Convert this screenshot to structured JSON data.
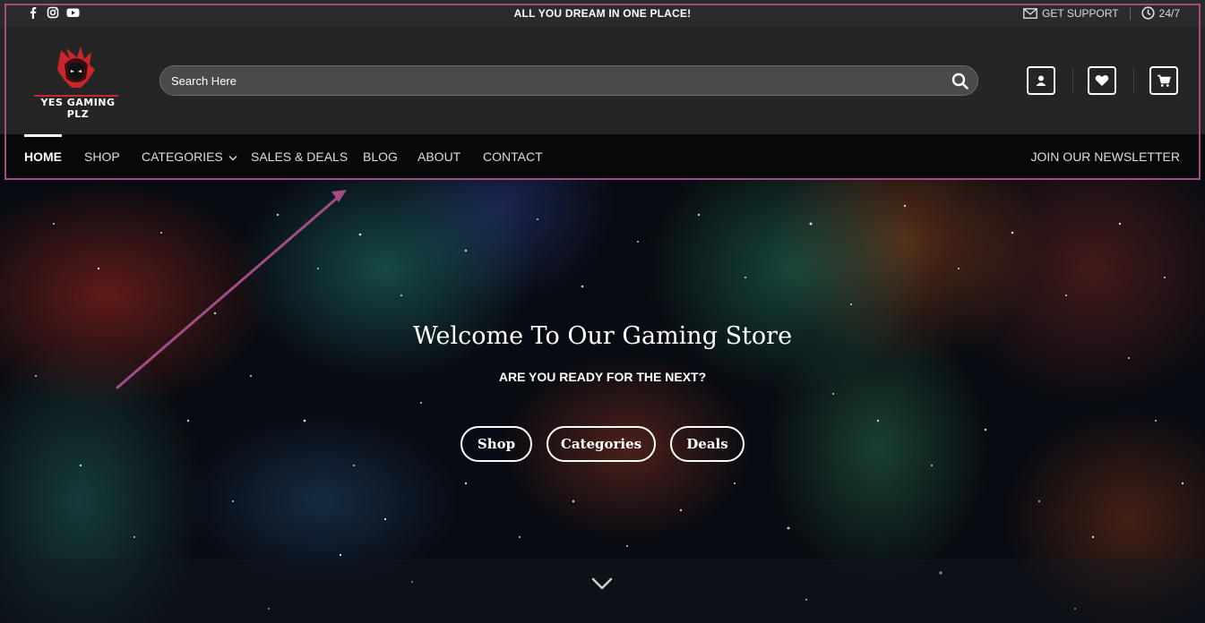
{
  "topbar": {
    "social_icons": [
      "facebook-icon",
      "instagram-icon",
      "youtube-icon"
    ],
    "tagline": "ALL YOU DREAM IN ONE PLACE!",
    "support_label": "GET SUPPORT",
    "hours_label": "24/7"
  },
  "header": {
    "logo_text": "YES GAMING PLZ",
    "search_placeholder": "Search Here",
    "icons": [
      "user-icon",
      "heart-icon",
      "cart-icon"
    ]
  },
  "nav": {
    "items": [
      {
        "label": "HOME",
        "active": true
      },
      {
        "label": "SHOP"
      },
      {
        "label": "CATEGORIES"
      },
      {
        "label": "SALES & DEALS"
      },
      {
        "label": "BLOG"
      },
      {
        "label": "ABOUT"
      },
      {
        "label": "CONTACT"
      }
    ],
    "newsletter_label": "JOIN OUR NEWSLETTER"
  },
  "hero": {
    "title": "Welcome To Our Gaming Store",
    "subtitle": "ARE YOU READY FOR THE NEXT?",
    "buttons": [
      "Shop",
      "Categories",
      "Deals"
    ]
  },
  "colors": {
    "annotation": "#a14d86",
    "topbar_bg": "#2b2b2b",
    "header_bg": "#252525",
    "nav_bg": "#080808",
    "logo_red": "#c8262c"
  }
}
